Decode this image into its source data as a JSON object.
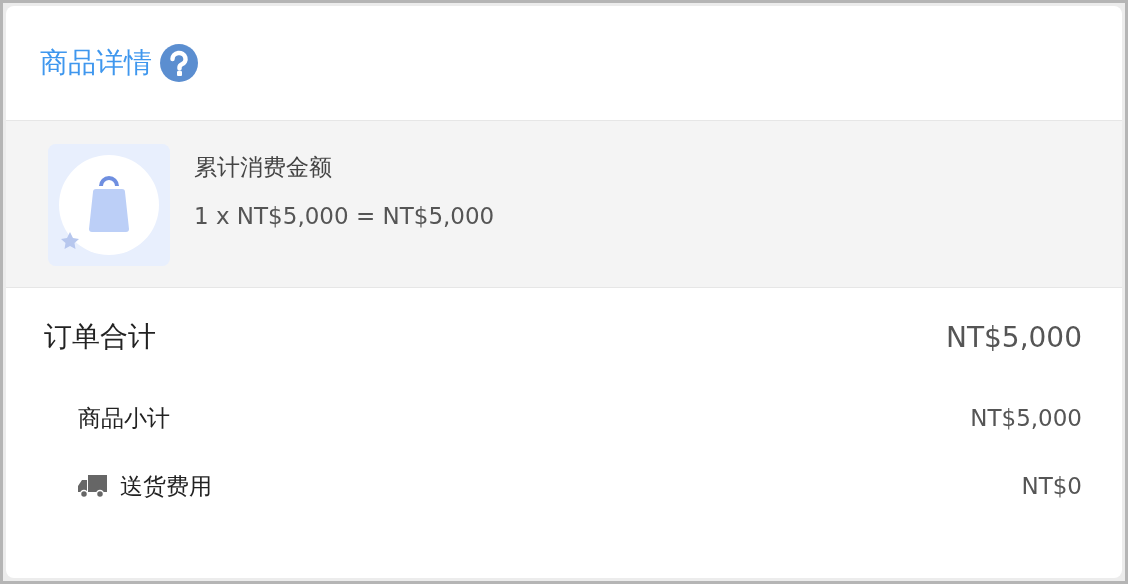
{
  "header": {
    "title": "商品详情"
  },
  "items": [
    {
      "name": "累计消费金额",
      "detail": "1 x NT$5,000 = NT$5,000"
    }
  ],
  "summary": {
    "total_label": "订单合计",
    "total_value": "NT$5,000",
    "rows": [
      {
        "kind": "subtotal",
        "label": "商品小计",
        "value": "NT$5,000"
      },
      {
        "kind": "shipping",
        "label": "送货费用",
        "value": "NT$0"
      }
    ]
  }
}
